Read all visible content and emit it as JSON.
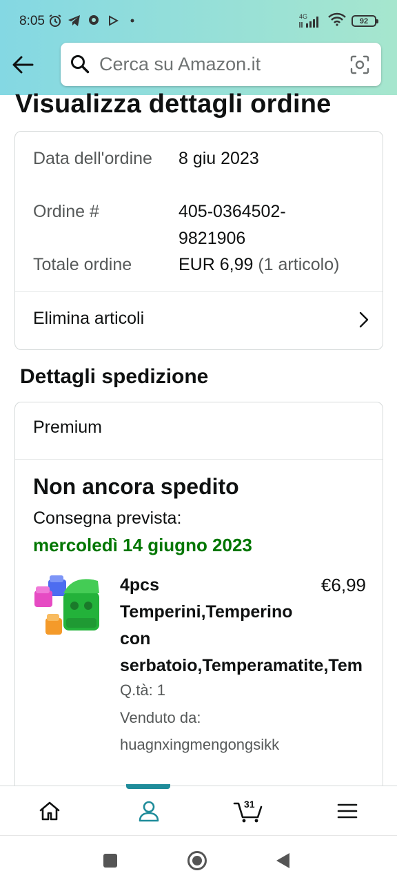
{
  "status_bar": {
    "time": "8:05",
    "network": "4G",
    "battery": "92"
  },
  "search": {
    "placeholder": "Cerca su Amazon.it"
  },
  "page": {
    "title": "Visualizza dettagli ordine"
  },
  "order_summary": {
    "date_label": "Data dell'ordine",
    "date_value": "8 giu 2023",
    "order_label": "Ordine #",
    "order_value": "405-0364502-9821906",
    "total_label": "Totale ordine",
    "total_value": "EUR 6,99",
    "total_items": "(1 articolo)",
    "delete_items_label": "Elimina articoli"
  },
  "shipment": {
    "section_title": "Dettagli spedizione",
    "service": "Premium",
    "status": "Non ancora spedito",
    "delivery_label": "Consegna prevista:",
    "delivery_date": "mercoledì 14 giugno 2023",
    "product": {
      "title_lines": [
        "4pcs",
        "Temperini,Temperino",
        "con",
        "serbatoio,Temperamatite,Tem"
      ],
      "price": "€6,99",
      "quantity": "Q.tà: 1",
      "seller_label": "Venduto da:",
      "seller": "huagnxingmengongsikk"
    }
  },
  "bottom_nav": {
    "items": [
      "home-icon",
      "account-icon",
      "cart-icon",
      "menu-icon"
    ],
    "active": "account-icon",
    "cart_count": "31"
  },
  "colors": {
    "header_gradient_start": "#84d8e3",
    "header_gradient_end": "#a6e6ce",
    "delivery_green": "#007600",
    "active_indicator": "#1f8c9a"
  }
}
